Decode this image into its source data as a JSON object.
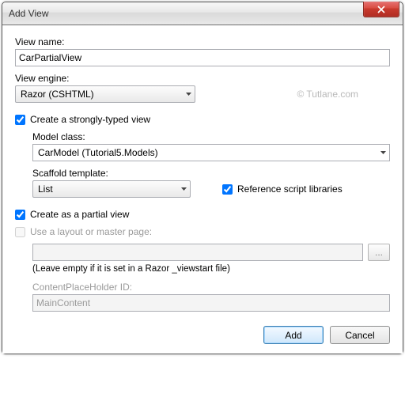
{
  "window": {
    "title": "Add View"
  },
  "labels": {
    "view_name": "View name:",
    "view_engine": "View engine:",
    "model_class": "Model class:",
    "scaffold_template": "Scaffold template:",
    "content_placeholder": "ContentPlaceHolder ID:"
  },
  "fields": {
    "view_name_value": "CarPartialView",
    "view_engine_value": "Razor (CSHTML)",
    "model_class_value": "CarModel (Tutorial5.Models)",
    "scaffold_value": "List",
    "layout_path_value": "",
    "content_placeholder_value": "MainContent"
  },
  "checkboxes": {
    "strongly_typed": {
      "label": "Create a strongly-typed view",
      "checked": true
    },
    "reference_scripts": {
      "label": "Reference script libraries",
      "checked": true
    },
    "partial_view": {
      "label": "Create as a partial view",
      "checked": true
    },
    "use_layout": {
      "label": "Use a layout or master page:",
      "checked": false
    }
  },
  "hint": "(Leave empty if it is set in a Razor _viewstart file)",
  "buttons": {
    "add": "Add",
    "cancel": "Cancel",
    "browse": "..."
  },
  "watermark": "© Tutlane.com"
}
